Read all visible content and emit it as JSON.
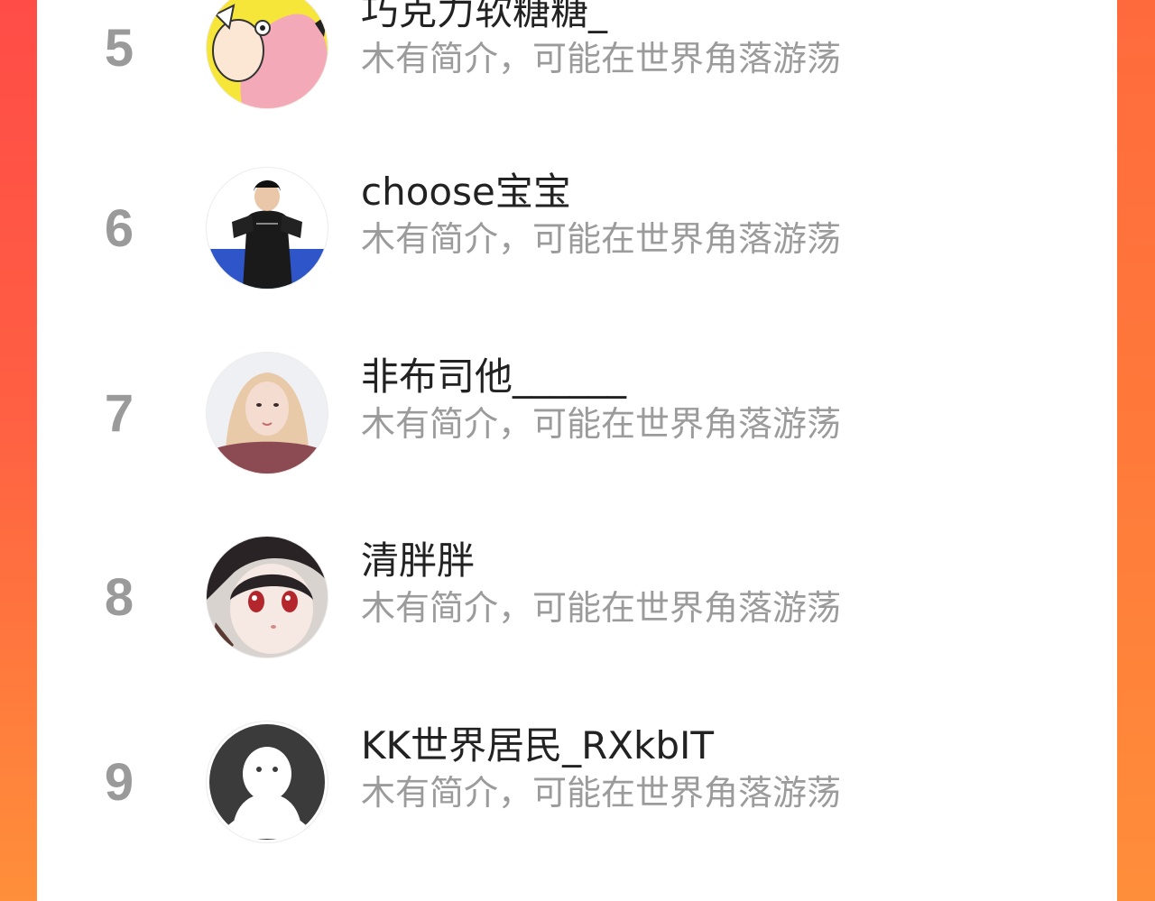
{
  "accent_colors": {
    "background_gradient_top": "#ff4c47",
    "background_gradient_bottom": "#ff8f3a",
    "card": "#ffffff",
    "rank_text": "#9a9a9a",
    "name_text": "#222222",
    "bio_text": "#9b9b9b"
  },
  "list": {
    "items": [
      {
        "rank": "5",
        "name": "巧克力软糖糖_",
        "bio": "木有简介，可能在世界角落游荡",
        "avatar": "cartoon-pink-hair-avatar"
      },
      {
        "rank": "6",
        "name": "choose宝宝",
        "bio": "木有简介，可能在世界角落游荡",
        "avatar": "boy-black-jacket-avatar"
      },
      {
        "rank": "7",
        "name": "非布司他______",
        "bio": "木有简介，可能在世界角落游荡",
        "avatar": "blonde-girl-photo-avatar"
      },
      {
        "rank": "8",
        "name": "清胖胖",
        "bio": "木有简介，可能在世界角落游荡",
        "avatar": "anime-girl-avatar"
      },
      {
        "rank": "9",
        "name": "KK世界居民_RXkbIT",
        "bio": "木有简介，可能在世界角落游荡",
        "avatar": "default-ghost-avatar"
      }
    ]
  }
}
